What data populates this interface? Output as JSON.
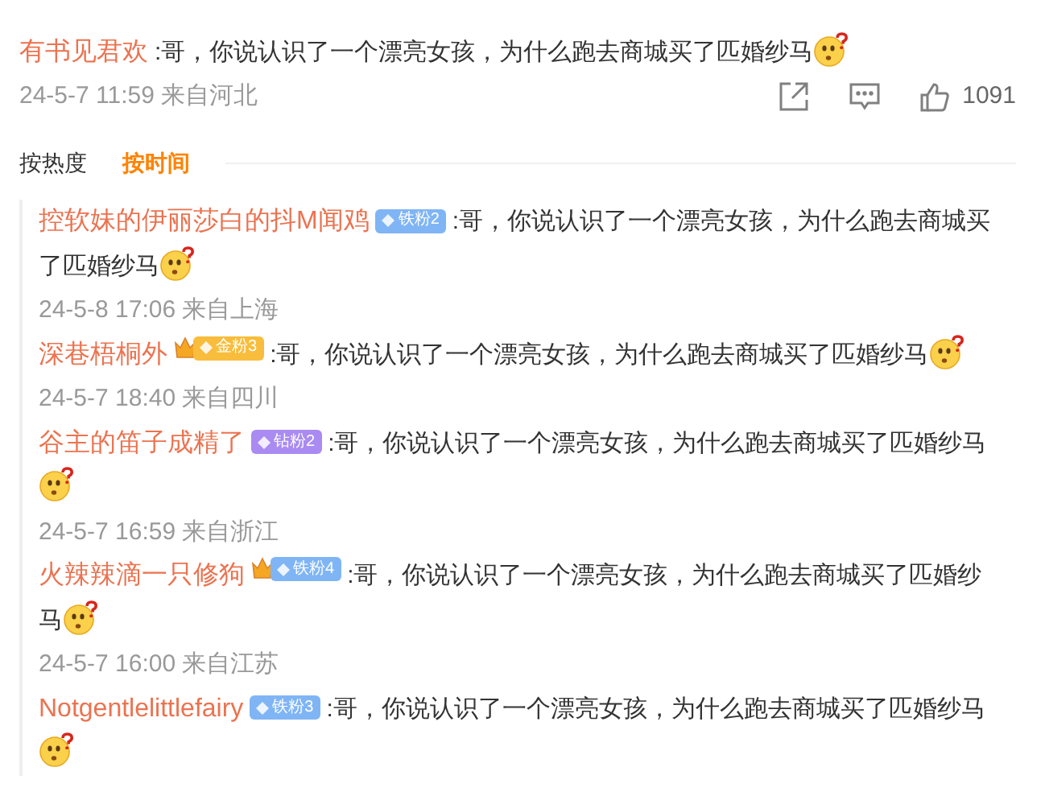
{
  "comment": {
    "author": "有书见君欢",
    "text": ":哥，你说认识了一个漂亮女孩，为什么跑去商城买了匹婚纱马",
    "meta": "24-5-7 11:59 来自河北",
    "likes": "1091"
  },
  "sort_tabs": [
    {
      "label": "按热度",
      "selected": false
    },
    {
      "label": "按时间",
      "selected": true
    }
  ],
  "replies": [
    {
      "author": "控软妹的伊丽莎白的抖M闻鸡",
      "badge": {
        "label": "铁粉2",
        "color": "#7fb5f5",
        "crown": false
      },
      "text": ":哥，你说认识了一个漂亮女孩，为什么跑去商城买了匹婚纱马",
      "meta": "24-5-8 17:06 来自上海"
    },
    {
      "author": "深巷梧桐外",
      "badge": {
        "label": "金粉3",
        "color": "#f8bd3c",
        "crown": true
      },
      "text": ":哥，你说认识了一个漂亮女孩，为什么跑去商城买了匹婚纱马",
      "meta": "24-5-7 18:40 来自四川"
    },
    {
      "author": "谷主的笛子成精了",
      "badge": {
        "label": "钻粉2",
        "color": "#a98bf2",
        "crown": false
      },
      "text": ":哥，你说认识了一个漂亮女孩，为什么跑去商城买了匹婚纱马",
      "meta": "24-5-7 16:59 来自浙江"
    },
    {
      "author": "火辣辣滴一只修狗",
      "badge": {
        "label": "铁粉4",
        "color": "#7fb5f5",
        "crown": true
      },
      "text": ":哥，你说认识了一个漂亮女孩，为什么跑去商城买了匹婚纱马",
      "meta": "24-5-7 16:00 来自江苏"
    },
    {
      "author": "Notgentlelittlefairy",
      "badge": {
        "label": "铁粉3",
        "color": "#7fb5f5",
        "crown": false
      },
      "text": ":哥，你说认识了一个漂亮女孩，为什么跑去商城买了匹婚纱马"
    }
  ]
}
